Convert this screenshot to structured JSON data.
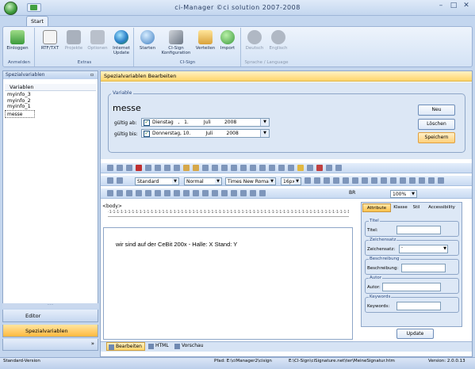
{
  "window": {
    "title": "ci-Manager ©ci solution 2007-2008"
  },
  "ribbon": {
    "tab": "Start",
    "groups": [
      {
        "label": "Anmelden"
      },
      {
        "label": "Extras"
      },
      {
        "label": "CI-Sign"
      },
      {
        "label": "Sprache / Language"
      }
    ],
    "buttons": [
      {
        "label": "Einloggen",
        "icon": "login-icon"
      },
      {
        "label": "RTF/TXT",
        "icon": "rtf-txt-icon"
      },
      {
        "label": "Projekte",
        "icon": "projects-icon"
      },
      {
        "label": "Optionen",
        "icon": "options-icon"
      },
      {
        "label": "Internet Update",
        "icon": "internet-update-icon"
      },
      {
        "label": "Starten",
        "icon": "start-icon"
      },
      {
        "label": "CI-Sign Konfiguration",
        "icon": "config-icon"
      },
      {
        "label": "Verteilen",
        "icon": "distribute-icon"
      },
      {
        "label": "Import",
        "icon": "import-icon"
      },
      {
        "label": "Deutsch",
        "icon": "deutsch-icon"
      },
      {
        "label": "Englisch",
        "icon": "englisch-icon"
      }
    ]
  },
  "left": {
    "header": "Spezialvariablen",
    "column": "Variablen",
    "items": [
      "myinfo_3",
      "myinfo_2",
      "myinfo_1",
      "messe"
    ],
    "nav": [
      "Editor",
      "Spezialvariablen"
    ]
  },
  "main": {
    "header": "Spezialvariablen Bearbeiten",
    "fieldset": "Variable",
    "name": "messe",
    "valid_from_label": "gültig ab:",
    "valid_from": "Dienstag   ,   1.          Juli         2008",
    "valid_to_label": "gültig bis:",
    "valid_to": "Donnerstag, 10.          Juli         2008",
    "buttons": {
      "new": "Neu",
      "delete": "Löschen",
      "save": "Speichern"
    }
  },
  "editor": {
    "style": "Standard",
    "format": "Normal",
    "font": "Times New Roman",
    "size": "16px",
    "br": "BR",
    "zoom": "100%",
    "body_tag": "<body>",
    "content": "wir sind auf der CeBit 200x - Halle: X Stand: Y",
    "tabs": [
      "Bearbeiten",
      "HTML",
      "Vorschau"
    ]
  },
  "attributes": {
    "tabs": [
      "Attribute",
      "Klasse",
      "Stil",
      "Accessibility"
    ],
    "groups": [
      {
        "title": "Titel",
        "label": "Titel:"
      },
      {
        "title": "Zeichensatz",
        "label": "Zeichensatz:",
        "value": "-"
      },
      {
        "title": "Beschreibung",
        "label": "Beschreibung:"
      },
      {
        "title": "Autor",
        "label": "Autor:"
      },
      {
        "title": "Keywords",
        "label": "Keywords:"
      }
    ],
    "update": "Update"
  },
  "status": {
    "left": "Standard-Version",
    "path": "Pfad: E:\\ciManager2\\cisign",
    "file": "E:\\CI-Sign\\ciSignature.net\\ter\\MeineSignatur.htm",
    "version": "Version: 2.0.0.13"
  }
}
